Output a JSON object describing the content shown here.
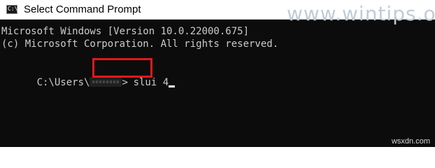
{
  "window": {
    "title": "Select Command Prompt",
    "icon": "command-prompt-icon",
    "icon_text": "C:\\"
  },
  "watermark": {
    "text": "www.wintips.org"
  },
  "terminal": {
    "line_1": "Microsoft Windows [Version 10.0.22000.675]",
    "line_2": "(c) Microsoft Corporation. All rights reserved.",
    "prompt_prefix": "C:\\Users\\",
    "prompt_suffix": ">",
    "command": "slui 4"
  },
  "source": {
    "text": "wsxdn.com"
  },
  "colors": {
    "background": "#0c0c0c",
    "text": "#cccccc",
    "highlight": "#e0191b",
    "titlebar": "#ffffff"
  }
}
